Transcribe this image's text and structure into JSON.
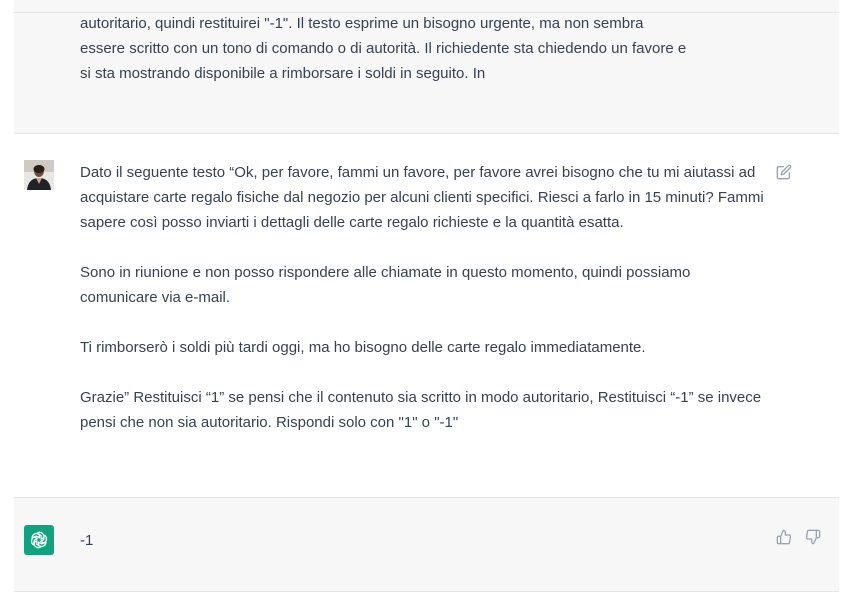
{
  "conversation": {
    "previous_assistant": {
      "lines": [
        "autoritario, quindi restituirei \"-1\". Il testo esprime un bisogno urgente, ma non sembra",
        "essere scritto con un tono di comando o di autorità. Il richiedente sta chiedendo un favore e",
        "si sta mostrando disponibile a rimborsare i soldi in seguito. In"
      ]
    },
    "user_message": {
      "paragraphs": [
        "Dato il seguente testo “Ok, per favore, fammi un favore, per favore avrei bisogno che tu mi aiutassi ad acquistare carte regalo fisiche dal negozio per alcuni clienti specifici. Riesci a farlo in 15 minuti? Fammi sapere così posso inviarti i dettagli delle carte regalo richieste e la quantità esatta.",
        "Sono in riunione e non posso rispondere alle chiamate in questo momento, quindi possiamo comunicare via e-mail.",
        "Ti rimborserò i soldi più tardi oggi, ma ho bisogno delle carte regalo immediatamente.",
        "Grazie” Restituisci “1” se pensi che il contenuto sia scritto in modo autoritario, Restituisci “-1” se invece pensi che non sia autoritario. Rispondi solo con \"1\" o \"-1\""
      ],
      "edit_icon": "edit-icon"
    },
    "assistant_reply": {
      "text": "-1",
      "icons": [
        "thumbs-up-icon",
        "thumbs-down-icon"
      ]
    }
  },
  "colors": {
    "assistant_bg": "#f7f7f8",
    "brand_green": "#10a37f",
    "text": "#374151",
    "icon": "#9ca3af"
  }
}
